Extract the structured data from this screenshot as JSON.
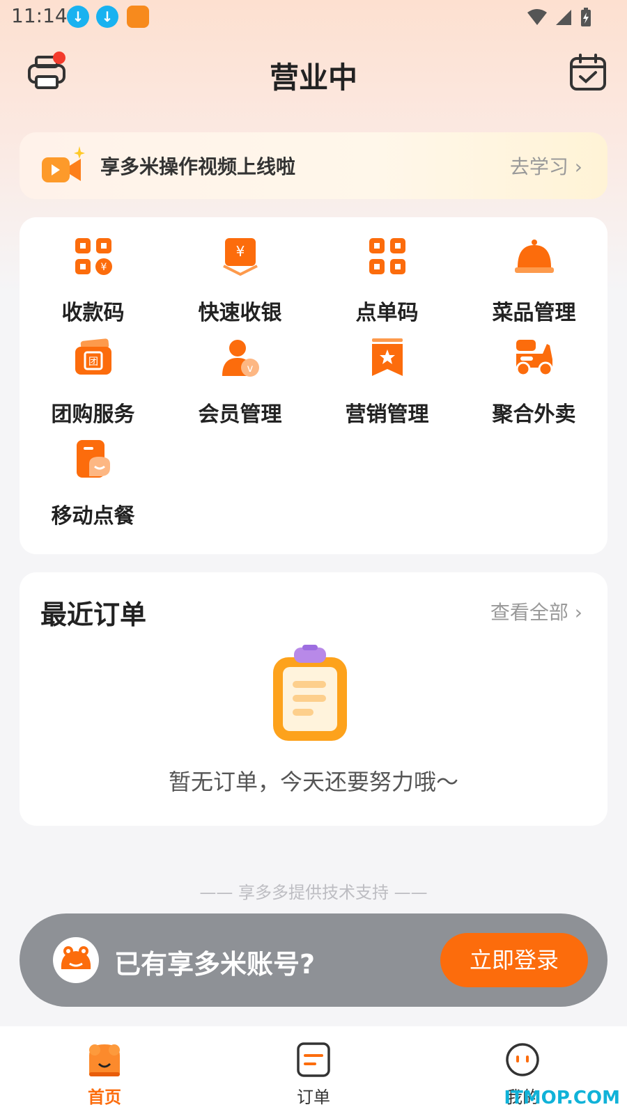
{
  "status_bar": {
    "time": "11:14"
  },
  "header": {
    "title": "营业中"
  },
  "banner": {
    "text": "享多米操作视频上线啦",
    "link": "去学习 ›"
  },
  "tools": [
    {
      "label": "收款码",
      "icon": "qr-payment-icon"
    },
    {
      "label": "快速收银",
      "icon": "cashier-icon"
    },
    {
      "label": "点单码",
      "icon": "order-code-icon"
    },
    {
      "label": "菜品管理",
      "icon": "dish-cloche-icon"
    },
    {
      "label": "团购服务",
      "icon": "group-buy-icon"
    },
    {
      "label": "会员管理",
      "icon": "member-icon"
    },
    {
      "label": "营销管理",
      "icon": "marketing-icon"
    },
    {
      "label": "聚合外卖",
      "icon": "delivery-scooter-icon"
    },
    {
      "label": "移动点餐",
      "icon": "mobile-order-icon"
    }
  ],
  "recent_orders": {
    "title": "最近订单",
    "link": "查看全部 ›",
    "empty_text": "暂无订单，今天还要努力哦～"
  },
  "support_text": "—— 享多多提供技术支持 ——",
  "login_bar": {
    "text": "已有享多米账号?",
    "button": "立即登录"
  },
  "tabs": [
    {
      "label": "首页",
      "active": true
    },
    {
      "label": "订单",
      "active": false
    },
    {
      "label": "我的",
      "active": false
    }
  ],
  "watermark": "ITMOP.COM",
  "colors": {
    "accent": "#fc6c0c",
    "badge": "#f33b2c"
  }
}
